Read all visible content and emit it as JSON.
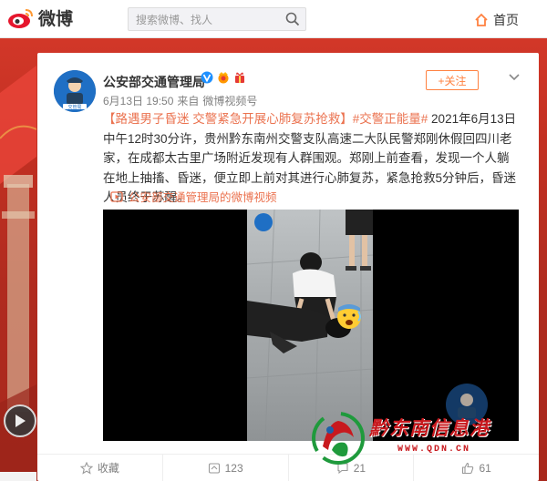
{
  "header": {
    "logo_text": "微博",
    "search_placeholder": "搜索微博、找人",
    "home_label": "首页"
  },
  "post": {
    "author": "公安部交通管理局",
    "follow_label": "+关注",
    "date": "6月13日 19:50",
    "source_prefix": "来自",
    "source": "微博视频号",
    "title": "【路遇男子昏迷 交警紧急开展心肺复苏抢救】",
    "hashtag": "#交警正能量#",
    "body": " 2021年6月13日中午12时30分许，贵州黔东南州交警支队高速二大队民警郑刚休假回四川老家，在成都太古里广场附近发现有人群围观。郑刚上前查看，发现一个人躺在地上抽搐、昏迷，便立即上前对其进行心肺复苏，紧急抢救5分钟后，昏迷人员终于苏醒。",
    "video_link": "公安部交通管理局的微博视频",
    "avatar_caption": "交管局"
  },
  "actions": {
    "favorite": "收藏",
    "repost_count": "123",
    "comment_count": "21",
    "like_count": "61"
  },
  "watermark": {
    "title": "黔东南信息港",
    "url": "WWW.QDN.CN"
  },
  "colors": {
    "accent": "#ff8140",
    "link": "#eb7350",
    "background_red": "#c23022"
  }
}
